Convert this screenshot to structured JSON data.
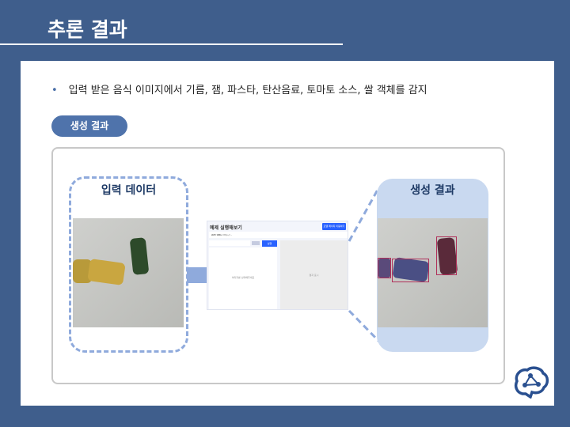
{
  "title": "추론 결과",
  "bullet": "입력 받은 음식 이미지에서 기름, 잼, 파스타, 탄산음료, 토마토 소스, 쌀 객체를 감지",
  "section_pill": "생성 결과",
  "input_label": "입력 데이터",
  "output_label": "생성 결과",
  "mockup": {
    "title": "예제 실행해보기",
    "top_button": "모델 페이지 이동하기",
    "url_label": "API URL",
    "url": "http://...",
    "run_button": "실행",
    "left_placeholder": "이미지를 선택해주세요",
    "right_placeholder": "결과 표시"
  },
  "colors": {
    "background": "#3f5e8c",
    "accent": "#4f73ab",
    "result_box": "#c9d9f0",
    "bbox": "#b0305a"
  }
}
